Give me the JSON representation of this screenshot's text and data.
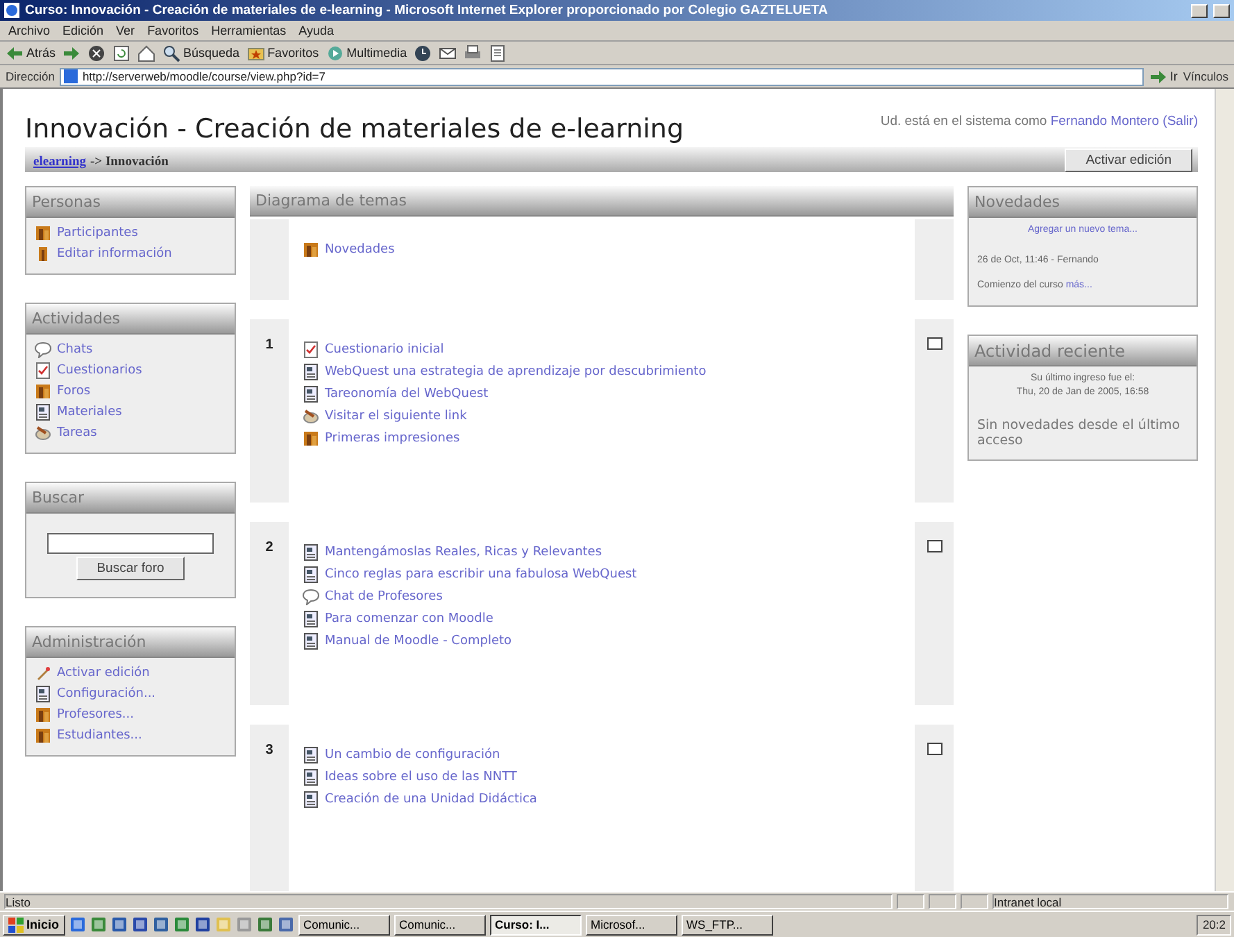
{
  "window": {
    "title": "Curso: Innovación - Creación de materiales de e-learning - Microsoft Internet Explorer proporcionado por Colegio GAZTELUETA"
  },
  "menu": [
    "Archivo",
    "Edición",
    "Ver",
    "Favoritos",
    "Herramientas",
    "Ayuda"
  ],
  "toolbar": [
    {
      "kind": "back",
      "label": "Atrás"
    },
    {
      "kind": "forward"
    },
    {
      "kind": "stop"
    },
    {
      "kind": "refresh"
    },
    {
      "kind": "home"
    },
    {
      "kind": "search",
      "label": "Búsqueda"
    },
    {
      "kind": "favorites",
      "label": "Favoritos"
    },
    {
      "kind": "media",
      "label": "Multimedia"
    },
    {
      "kind": "history"
    },
    {
      "kind": "mail"
    },
    {
      "kind": "print"
    },
    {
      "kind": "edit"
    }
  ],
  "address": {
    "label": "Dirección",
    "value": "http://serverweb/moodle/course/view.php?id=7",
    "go": "Ir",
    "links": "Vínculos"
  },
  "page": {
    "title": "Innovación - Creación de materiales de e-learning",
    "login_prefix": "Ud. está en el sistema como",
    "user": "Fernando Montero",
    "logout": "(Salir)",
    "breadcrumb": [
      {
        "label": "elearning",
        "link": true
      },
      {
        "label": "-> Innovación",
        "link": false
      }
    ],
    "edit_button": "Activar edición"
  },
  "left_blocks": [
    {
      "kind": "list",
      "title": "Personas",
      "items": [
        {
          "kind": "people",
          "label": "Participantes"
        },
        {
          "kind": "person",
          "label": "Editar información"
        }
      ]
    },
    {
      "kind": "list",
      "title": "Actividades",
      "items": [
        {
          "kind": "chat",
          "label": "Chats"
        },
        {
          "kind": "quiz",
          "label": "Cuestionarios"
        },
        {
          "kind": "forum",
          "label": "Foros"
        },
        {
          "kind": "resource",
          "label": "Materiales"
        },
        {
          "kind": "assignment",
          "label": "Tareas"
        }
      ]
    },
    {
      "kind": "search",
      "title": "Buscar",
      "button": "Buscar foro"
    },
    {
      "kind": "list",
      "title": "Administración",
      "items": [
        {
          "kind": "edit",
          "label": "Activar edición"
        },
        {
          "kind": "settings",
          "label": "Configuración..."
        },
        {
          "kind": "people",
          "label": "Profesores..."
        },
        {
          "kind": "people",
          "label": "Estudiantes..."
        }
      ]
    }
  ],
  "topics": {
    "title": "Diagrama de temas",
    "sections": [
      {
        "items": [
          {
            "kind": "forum",
            "label": "Novedades"
          }
        ]
      },
      {
        "number": "1",
        "items": [
          {
            "kind": "quiz",
            "label": "Cuestionario inicial"
          },
          {
            "kind": "resource",
            "label": "WebQuest una estrategia de aprendizaje por descubrimiento"
          },
          {
            "kind": "resource",
            "label": "Tareonomía del WebQuest"
          },
          {
            "kind": "assignment",
            "label": "Visitar el siguiente link"
          },
          {
            "kind": "forum",
            "label": "Primeras impresiones"
          }
        ]
      },
      {
        "number": "2",
        "items": [
          {
            "kind": "resource",
            "label": "Mantengámoslas Reales, Ricas y Relevantes"
          },
          {
            "kind": "resource",
            "label": "Cinco reglas para escribir una fabulosa WebQuest"
          },
          {
            "kind": "chat",
            "label": "Chat de Profesores"
          },
          {
            "kind": "resource",
            "label": "Para comenzar con Moodle"
          },
          {
            "kind": "resource",
            "label": "Manual de Moodle - Completo"
          }
        ]
      },
      {
        "number": "3",
        "items": [
          {
            "kind": "resource",
            "label": "Un cambio de configuración"
          },
          {
            "kind": "resource",
            "label": "Ideas sobre el uso de las NNTT"
          },
          {
            "kind": "resource",
            "label": "Creación de una Unidad Didáctica"
          }
        ]
      }
    ]
  },
  "news": {
    "title": "Novedades",
    "add": "Agregar un nuevo tema...",
    "date": "26 de Oct, 11:46 - Fernando",
    "text": "Comienzo del curso",
    "more": "más..."
  },
  "recent": {
    "title": "Actividad reciente",
    "last_login": "Su último ingreso fue el:",
    "date": "Thu, 20 de Jan de 2005, 16:58",
    "message": "Sin novedades desde el último acceso"
  },
  "status": {
    "text": "Listo",
    "zone": "Intranet local"
  },
  "taskbar": {
    "start": "Inicio",
    "tasks": [
      {
        "label": "Comunic...",
        "selected": false
      },
      {
        "label": "Comunic...",
        "selected": false
      },
      {
        "label": "Curso: I...",
        "selected": true
      },
      {
        "label": "Microsof...",
        "selected": false
      },
      {
        "label": "WS_FTP...",
        "selected": false
      }
    ],
    "clock": "20:2"
  }
}
